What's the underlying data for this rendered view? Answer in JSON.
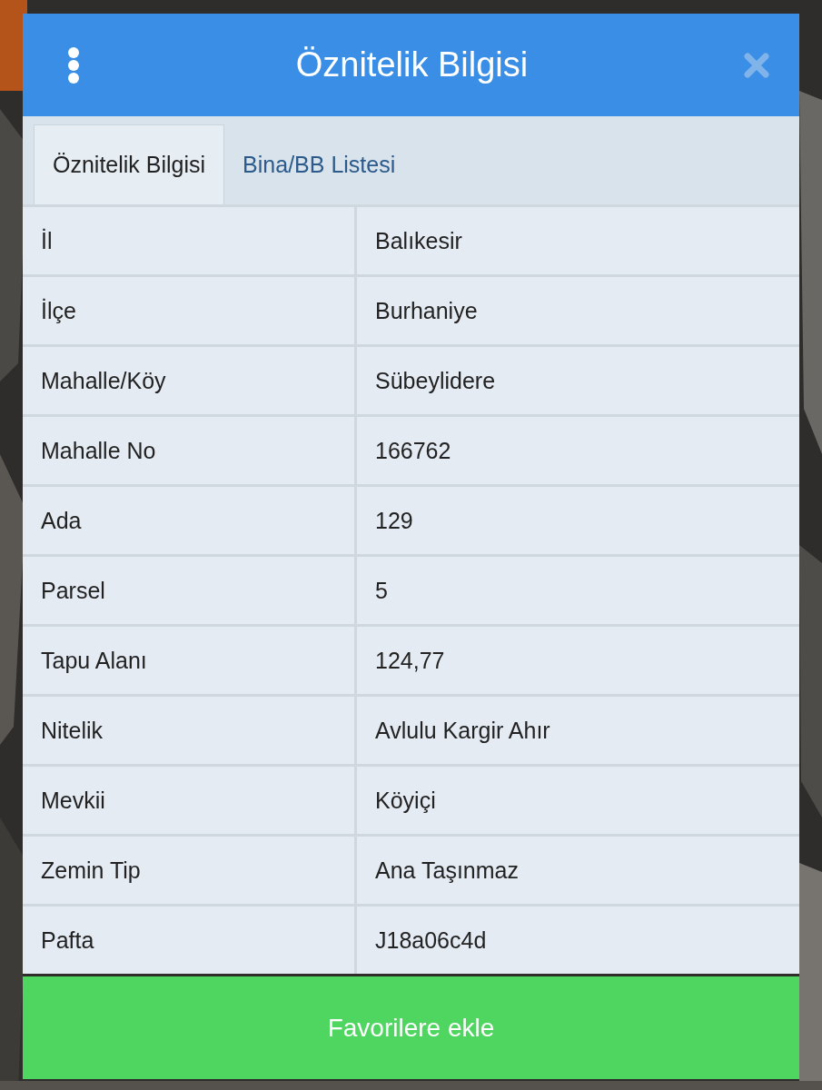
{
  "dialog": {
    "title": "Öznitelik Bilgisi"
  },
  "tabs": [
    {
      "label": "Öznitelik Bilgisi",
      "selected": true
    },
    {
      "label": "Bina/BB Listesi",
      "selected": false
    }
  ],
  "rows": [
    {
      "label": "İl",
      "value": "Balıkesir"
    },
    {
      "label": "İlçe",
      "value": "Burhaniye"
    },
    {
      "label": "Mahalle/Köy",
      "value": "Sübeylidere"
    },
    {
      "label": "Mahalle No",
      "value": "166762"
    },
    {
      "label": "Ada",
      "value": "129"
    },
    {
      "label": "Parsel",
      "value": "5"
    },
    {
      "label": "Tapu Alanı",
      "value": "124,77"
    },
    {
      "label": "Nitelik",
      "value": "Avlulu Kargir Ahır"
    },
    {
      "label": "Mevkii",
      "value": "Köyiçi"
    },
    {
      "label": "Zemin Tip",
      "value": "Ana Taşınmaz"
    },
    {
      "label": "Pafta",
      "value": "J18a06c4d"
    }
  ],
  "action_button": {
    "label": "Favorilere ekle"
  }
}
